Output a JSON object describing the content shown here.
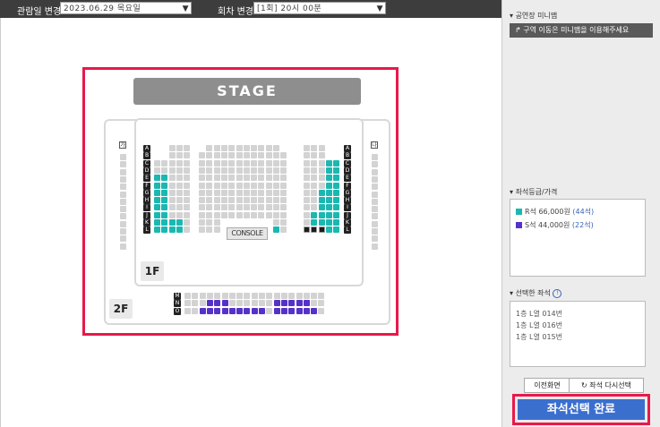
{
  "header": {
    "date_label": "관람일 변경",
    "date_value": "2023.06.29 목요일",
    "round_label": "회차 변경",
    "round_value": "[1회] 20시 00분"
  },
  "seatmap": {
    "stage": "STAGE",
    "console": "CONSOLE",
    "floor1": "1F",
    "floor2": "2F",
    "side_left": "가",
    "side_right": "나",
    "rows_1f": [
      "A",
      "B",
      "C",
      "D",
      "E",
      "F",
      "G",
      "H",
      "I",
      "J",
      "K",
      "L"
    ],
    "rows_2f": [
      "M",
      "N",
      "O"
    ],
    "colors": {
      "r_seat": "#1bb8b1",
      "s_seat": "#5631c9",
      "empty": "#d3d3d3",
      "selected": "#1c1c1c",
      "highlight": "#e8194a"
    }
  },
  "panel": {
    "minimap_title": "공연장 미니맵",
    "minimap_button": "구역 이동은 미니맵을 이용해주세요",
    "grade_title": "좌석등급/가격",
    "grades": [
      {
        "name": "R석",
        "price": "66,000원",
        "count": "(44석)",
        "color": "#1bb8b1"
      },
      {
        "name": "S석",
        "price": "44,000원",
        "count": "(22석)",
        "color": "#5631c9"
      }
    ],
    "selected_title": "선택한 좌석",
    "selected_seats": [
      "1층 L열 014번",
      "1층 L열 016번",
      "1층 L열 015번"
    ],
    "prev_button": "이전화면",
    "reset_button": "좌석 다시선택",
    "complete_button": "좌석선택 완료"
  }
}
